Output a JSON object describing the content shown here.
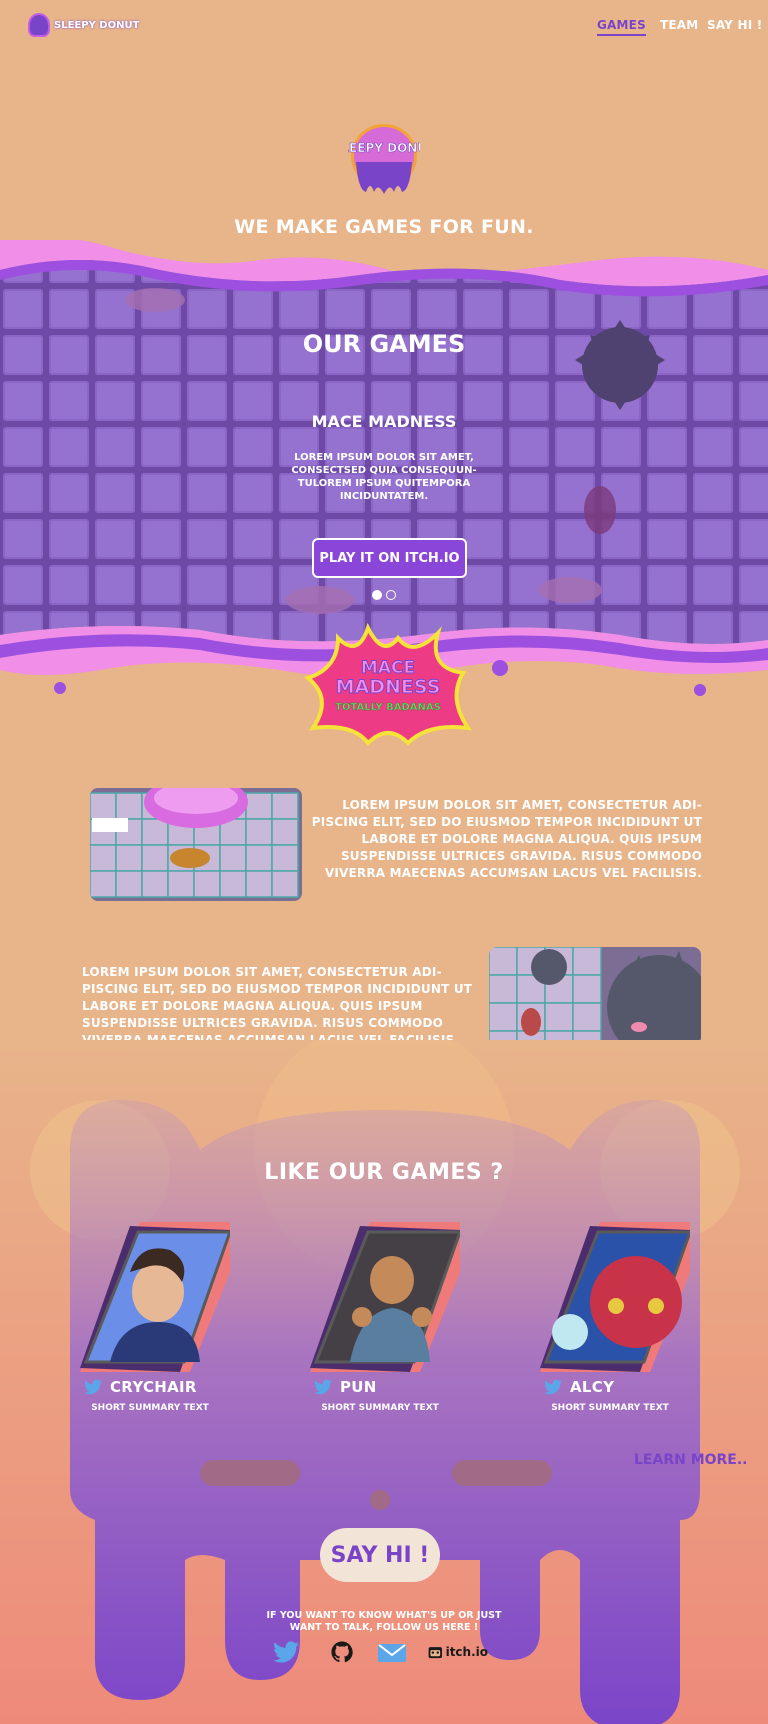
{
  "nav": {
    "brand": "SLEEPY DONUT",
    "links": [
      {
        "label": "GAMES",
        "active": true
      },
      {
        "label": "TEAM",
        "active": false
      },
      {
        "label": "SAY HI !",
        "active": false
      }
    ]
  },
  "hero": {
    "logo_text": "SLEEPY DONUT",
    "tagline": "WE MAKE GAMES FOR FUN."
  },
  "games": {
    "title": "OUR GAMES",
    "current": {
      "name": "MACE MADNESS",
      "description": "LOREM IPSUM DOLOR SIT AMET, CONSECTSED QUIA CONSEQUUN-TULOREM IPSUM QUITEMPORA INCIDUNTATEM.",
      "cta": "PLAY IT ON ITCH.IO",
      "badge_line1": "MACE",
      "badge_line2": "MADNESS",
      "badge_line3": "TOTALLY BADANAS"
    },
    "carousel": {
      "count": 2,
      "active": 1
    }
  },
  "features": [
    {
      "text": "LOREM IPSUM DOLOR SIT AMET, CONSECTETUR ADI-PISCING ELIT, SED DO EIUSMOD TEMPOR INCIDIDUNT UT LABORE ET DOLORE MAGNA ALIQUA. QUIS IPSUM SUSPENDISSE ULTRICES GRAVIDA. RISUS COMMODO VIVERRA MAECENAS ACCUMSAN LACUS VEL FACILISIS."
    },
    {
      "text": "LOREM IPSUM DOLOR SIT AMET, CONSECTETUR ADI-PISCING ELIT, SED DO EIUSMOD TEMPOR INCIDIDUNT UT LABORE ET DOLORE MAGNA ALIQUA. QUIS IPSUM SUSPENDISSE ULTRICES GRAVIDA. RISUS COMMODO VIVERRA MAECENAS ACCUMSAN LACUS VEL FACILISIS."
    }
  ],
  "like": {
    "title": "LIKE OUR GAMES ?",
    "members": [
      {
        "name": "CRYCHAIR",
        "summary": "SHORT SUMMARY TEXT"
      },
      {
        "name": "PUN",
        "summary": "SHORT SUMMARY TEXT"
      },
      {
        "name": "ALCY",
        "summary": "SHORT SUMMARY TEXT"
      }
    ],
    "learn_more": "LEARN MORE.."
  },
  "contact": {
    "say_hi": "SAY HI !",
    "text": "IF YOU WANT TO KNOW WHAT'S UP OR JUST WANT TO TALK, FOLLOW US HERE !",
    "socials": [
      {
        "icon": "twitter-icon"
      },
      {
        "icon": "github-icon"
      },
      {
        "icon": "mail-icon"
      },
      {
        "icon": "itch-icon",
        "label": "itch.io"
      }
    ]
  },
  "colors": {
    "background": "#e8b48a",
    "purple": "#7a44c9",
    "pink": "#f08ee8",
    "tile": "#8a63c8"
  }
}
